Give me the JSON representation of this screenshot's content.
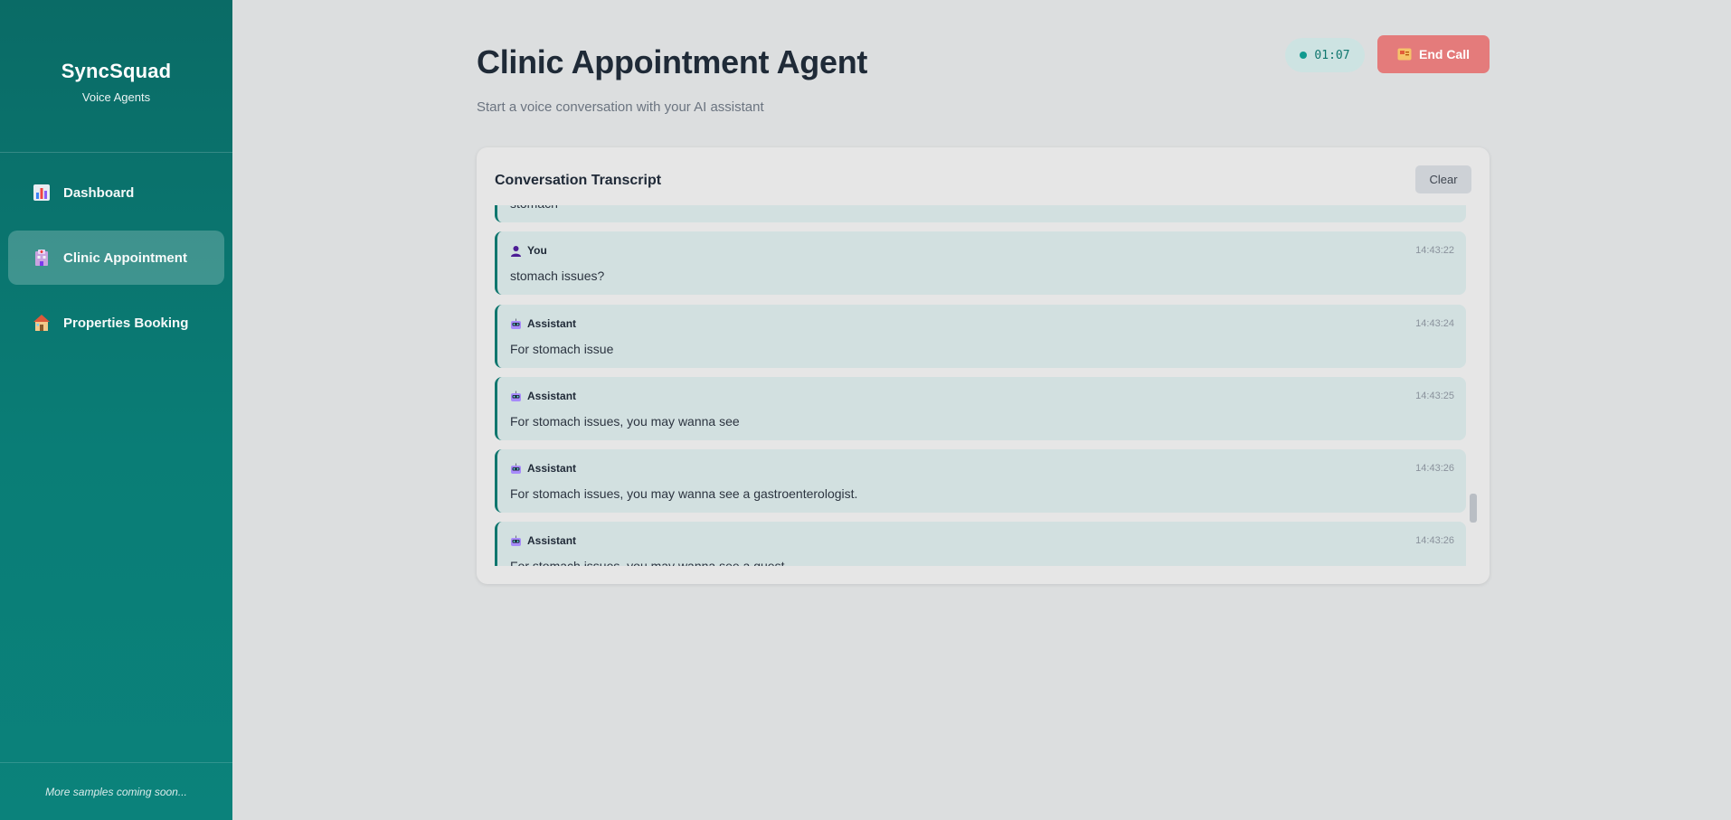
{
  "sidebar": {
    "brand_name": "SyncSquad",
    "brand_sub": "Voice Agents",
    "items": [
      {
        "label": "Dashboard",
        "icon": "chart-icon"
      },
      {
        "label": "Clinic Appointment",
        "icon": "hospital-icon",
        "active": true
      },
      {
        "label": "Properties Booking",
        "icon": "house-icon"
      }
    ],
    "footer": "More samples coming soon..."
  },
  "header": {
    "title": "Clinic Appointment Agent",
    "subtitle": "Start a voice conversation with your AI assistant",
    "timer": "01:07",
    "end_call_label": "End Call"
  },
  "transcript": {
    "title": "Conversation Transcript",
    "clear_label": "Clear",
    "messages": [
      {
        "speaker": "",
        "time": "",
        "text": "stomach",
        "icon": ""
      },
      {
        "speaker": "You",
        "time": "14:43:22",
        "text": "stomach issues?",
        "icon": "user-icon"
      },
      {
        "speaker": "Assistant",
        "time": "14:43:24",
        "text": "For stomach issue",
        "icon": "robot-icon"
      },
      {
        "speaker": "Assistant",
        "time": "14:43:25",
        "text": "For stomach issues, you may wanna see",
        "icon": "robot-icon"
      },
      {
        "speaker": "Assistant",
        "time": "14:43:26",
        "text": "For stomach issues, you may wanna see a gastroenterologist.",
        "icon": "robot-icon"
      },
      {
        "speaker": "Assistant",
        "time": "14:43:26",
        "text": "For stomach issues, you may wanna see a guest",
        "icon": "robot-icon"
      }
    ]
  },
  "colors": {
    "sidebar": "#0a7a74",
    "accent": "#0f766e",
    "end_call": "#e47b7b",
    "message_bg": "#d2e0e0"
  }
}
